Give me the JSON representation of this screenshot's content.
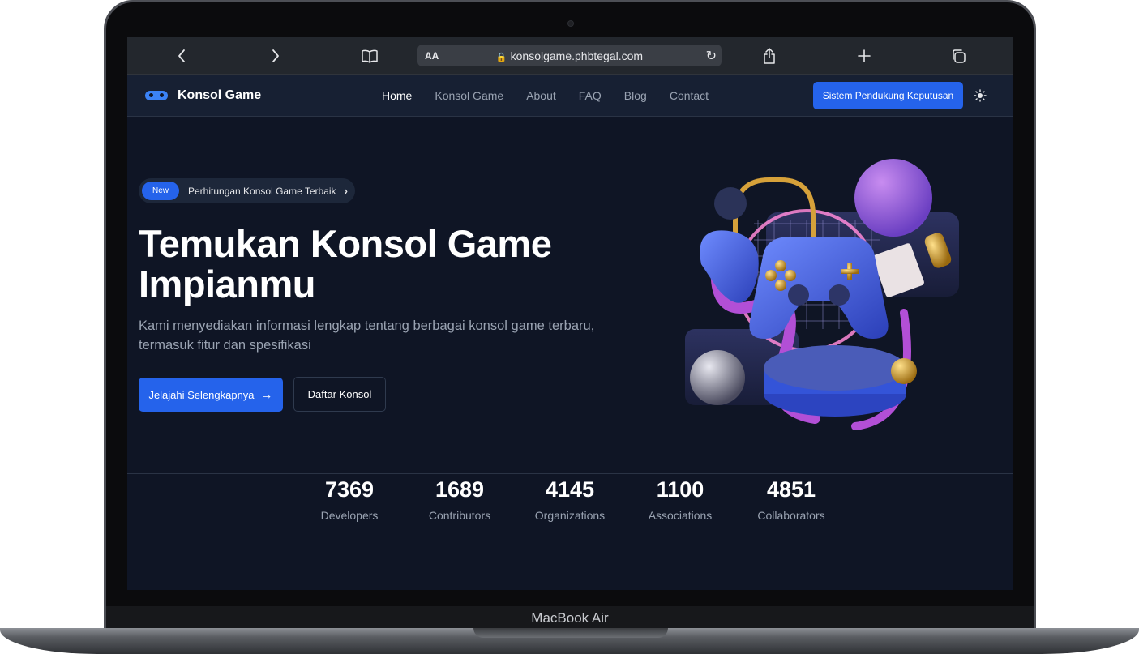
{
  "device": {
    "label": "MacBook Air"
  },
  "browser": {
    "url": "konsolgame.phbtegal.com",
    "text_size_label": "AA"
  },
  "nav": {
    "brand": "Konsol Game",
    "links": [
      "Home",
      "Konsol Game",
      "About",
      "FAQ",
      "Blog",
      "Contact"
    ],
    "active": "Home",
    "cta": "Sistem Pendukung Keputusan"
  },
  "hero": {
    "badge_new": "New",
    "badge_text": "Perhitungan Konsol Game Terbaik",
    "title": "Temukan Konsol Game Impianmu",
    "description": "Kami menyediakan informasi lengkap tentang berbagai konsol game terbaru, termasuk fitur dan spesifikasi",
    "primary_button": "Jelajahi Selengkapnya",
    "secondary_button": "Daftar Konsol"
  },
  "stats": [
    {
      "value": "7369",
      "label": "Developers"
    },
    {
      "value": "1689",
      "label": "Contributors"
    },
    {
      "value": "4145",
      "label": "Organizations"
    },
    {
      "value": "1100",
      "label": "Associations"
    },
    {
      "value": "4851",
      "label": "Collaborators"
    }
  ],
  "colors": {
    "background": "#0f1525",
    "nav_background": "#172033",
    "accent": "#2563eb",
    "text_muted": "#9aa3b2"
  }
}
